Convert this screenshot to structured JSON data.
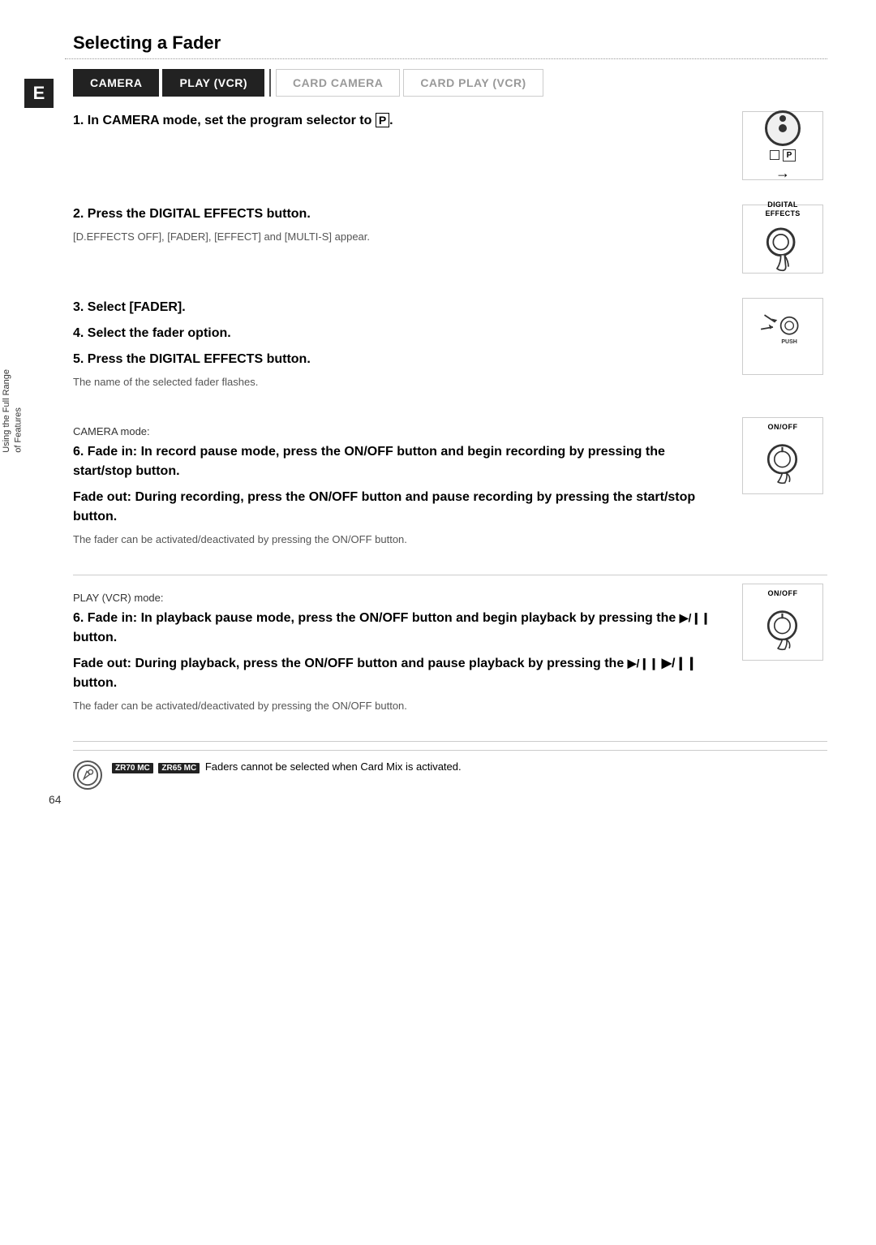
{
  "page": {
    "title": "Selecting a Fader",
    "page_number": "64",
    "e_badge": "E",
    "side_label_line1": "Using the Full Range",
    "side_label_line2": "of Features"
  },
  "tabs": [
    {
      "label": "CAMERA",
      "active": true
    },
    {
      "label": "PLAY (VCR)",
      "active": true
    },
    {
      "label": "CARD CAMERA",
      "active": false
    },
    {
      "label": "CARD PLAY (VCR)",
      "active": false
    }
  ],
  "steps": {
    "step1": "1. In CAMERA mode, set the program selector to",
    "step1_p": "P",
    "step1_dot": ".",
    "step2": "2. Press the DIGITAL EFFECTS button.",
    "step2_sub": "[D.EFFECTS OFF], [FADER], [EFFECT] and [MULTI-S] appear.",
    "step3": "3. Select [FADER].",
    "step4": "4. Select the fader option.",
    "step5": "5. Press the DIGITAL EFFECTS button.",
    "step5_sub": "The name of the selected fader flashes.",
    "camera_mode_label": "CAMERA mode:",
    "step6_camera": "6. Fade in: In record pause mode, press the ON/OFF button and begin recording by pressing the start/stop button.",
    "step6_camera_fadeout": "Fade out: During recording, press the ON/OFF button and pause recording by pressing the start/stop button.",
    "step6_camera_note": "The fader can be activated/deactivated by pressing the ON/OFF button.",
    "play_mode_label": "PLAY (VCR) mode:",
    "step6_play": "6. Fade in: In playback pause mode, press the ON/OFF button and begin playback by pressing the",
    "play_pause_symbol": "▶/❙❙",
    "step6_play_btn": "button.",
    "step6_play_fadeout": "Fade out: During playback, press the ON/OFF button and pause playback by pressing the",
    "step6_play_btn2": "▶/❙❙ button.",
    "step6_play_note": "The fader can be activated/deactivated by pressing the ON/OFF button.",
    "note_badge1": "ZR70 MC",
    "note_badge2": "ZR65 MC",
    "note_text": "Faders cannot be selected when Card Mix is activated."
  },
  "icons": {
    "digital_effects_label": "DIGITAL\nEFFECTS",
    "onoff_label": "ON/OFF",
    "push_label": "PUSH"
  }
}
